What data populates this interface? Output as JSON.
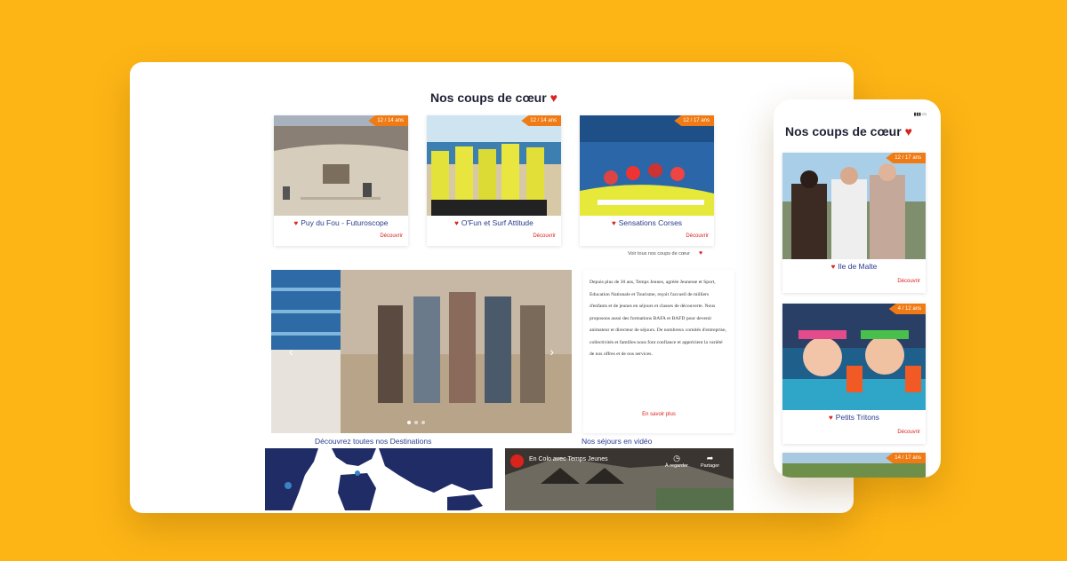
{
  "desktop": {
    "section_title": "Nos coups de cœur",
    "cards": [
      {
        "age": "12 / 14 ans",
        "name": "Puy du Fou - Futuroscope",
        "link": "Découvrir"
      },
      {
        "age": "12 / 14 ans",
        "name": "O'Fun et Surf Attitude",
        "link": "Découvrir"
      },
      {
        "age": "12 / 17 ans",
        "name": "Sensations Corses",
        "link": "Découvrir"
      }
    ],
    "see_all": "Voir tous nos coups de cœur",
    "about": {
      "text": "Depuis plus de 30 ans, Temps Jeunes, agréée Jeunesse et Sport, Education Nationale et Tourisme, reçoit l'accueil de milliers d'enfants et de jeunes en séjours et classes de découverte. Nous proposons aussi des formations BAFA et BAFD pour devenir animateur et directeur de séjours. De nombreux comités d'entreprise, collectivités et familles nous font confiance et apprécient la variété de nos offres et de nos services.",
      "link": "En savoir plus"
    },
    "destinations_title": "Découvrez toutes nos Destinations",
    "videos_title": "Nos séjours en vidéo",
    "video": {
      "title": "En Colo avec Temps Jeunes",
      "watch_later": "À regarder",
      "share": "Partager"
    }
  },
  "mobile": {
    "section_title": "Nos coups de cœur",
    "cards": [
      {
        "age": "12 / 17 ans",
        "name": "Ile de Malte",
        "link": "Découvrir"
      },
      {
        "age": "4 / 12 ans",
        "name": "Petits Tritons",
        "link": "Découvrir"
      },
      {
        "age": "14 / 17 ans"
      }
    ]
  },
  "colors": {
    "background": "#fdb515",
    "accent": "#f07b14",
    "heart": "#d9231d",
    "link_blue": "#2b3b8f"
  }
}
